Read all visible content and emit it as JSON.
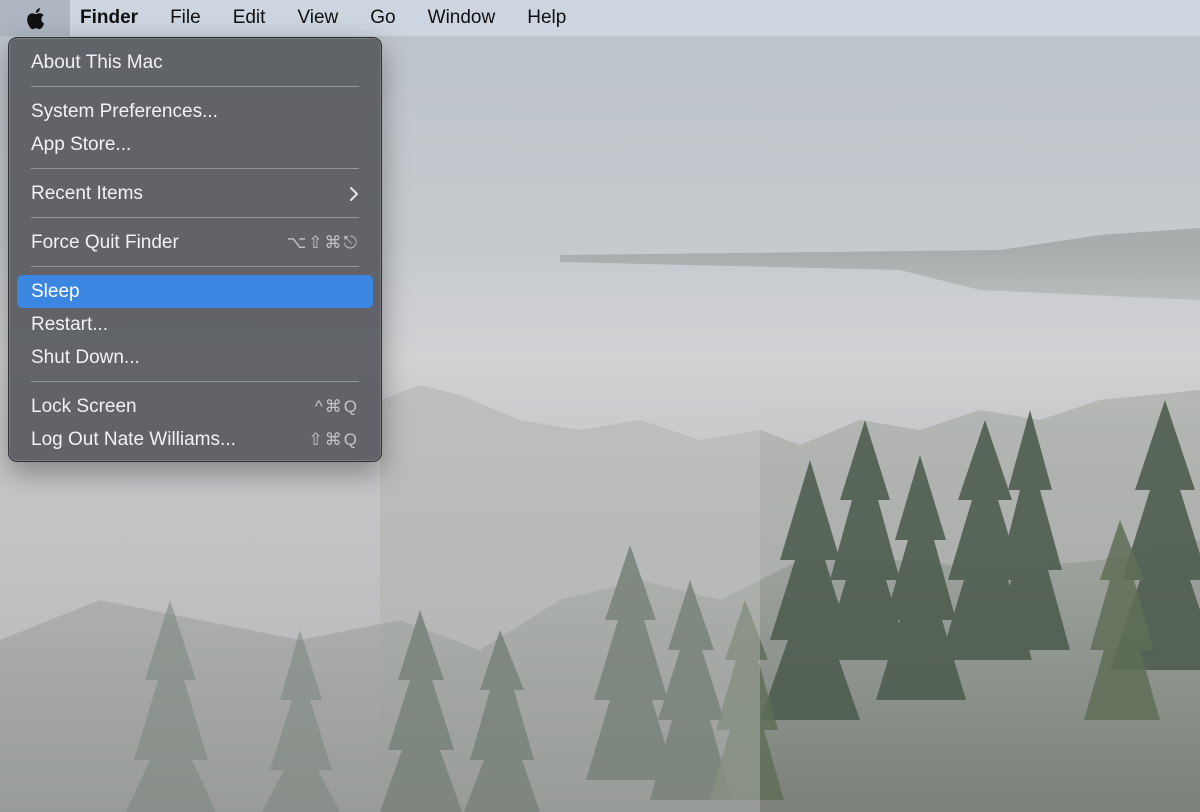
{
  "menubar": {
    "apple_icon": "apple-logo-icon",
    "items": [
      {
        "label": "Finder",
        "bold": true
      },
      {
        "label": "File"
      },
      {
        "label": "Edit"
      },
      {
        "label": "View"
      },
      {
        "label": "Go"
      },
      {
        "label": "Window"
      },
      {
        "label": "Help"
      }
    ]
  },
  "apple_menu": {
    "about": {
      "label": "About This Mac"
    },
    "system_preferences": {
      "label": "System Preferences..."
    },
    "app_store": {
      "label": "App Store..."
    },
    "recent_items": {
      "label": "Recent Items",
      "icon": "chevron-right-icon"
    },
    "force_quit": {
      "label": "Force Quit Finder",
      "shortcut": "⌥⇧⌘⎋"
    },
    "sleep": {
      "label": "Sleep",
      "selected": true
    },
    "restart": {
      "label": "Restart..."
    },
    "shut_down": {
      "label": "Shut Down..."
    },
    "lock_screen": {
      "label": "Lock Screen",
      "shortcut": "^⌘Q"
    },
    "log_out": {
      "label": "Log Out Nate Williams...",
      "shortcut": "⇧⌘Q"
    }
  },
  "colors": {
    "menubar_bg": "#cdd6e2",
    "menu_bg": "#5a5c62",
    "selection": "#3b86e0"
  }
}
